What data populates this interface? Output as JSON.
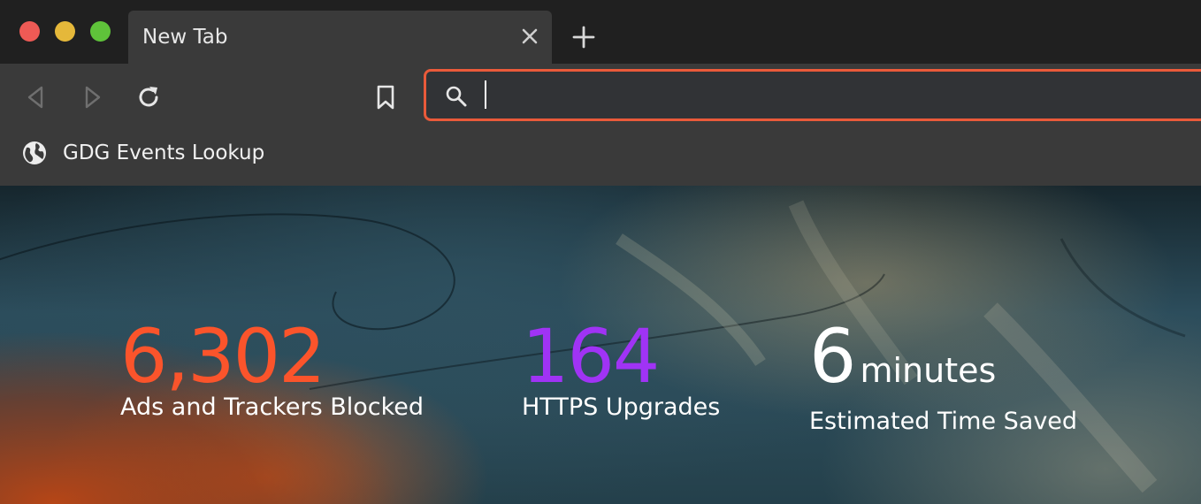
{
  "tab": {
    "title": "New Tab"
  },
  "urlbar": {
    "value": "",
    "placeholder": ""
  },
  "bookmarks": [
    {
      "label": "GDG Events Lookup"
    }
  ],
  "stats": {
    "ads_blocked": {
      "value": "6,302",
      "label": "Ads and Trackers Blocked"
    },
    "https_upgrades": {
      "value": "164",
      "label": "HTTPS Upgrades"
    },
    "time_saved": {
      "value": "6",
      "unit": "minutes",
      "label": "Estimated Time Saved"
    }
  },
  "colors": {
    "accent": "#ea5a3a",
    "ads_blocked": "#fb542b",
    "https_upgrades": "#a033f5",
    "time_saved": "#ffffff"
  },
  "icons": [
    "close-window",
    "minimize-window",
    "maximize-window",
    "close-icon",
    "plus-icon",
    "back-icon",
    "forward-icon",
    "reload-icon",
    "bookmark-icon",
    "search-icon",
    "globe-icon"
  ]
}
